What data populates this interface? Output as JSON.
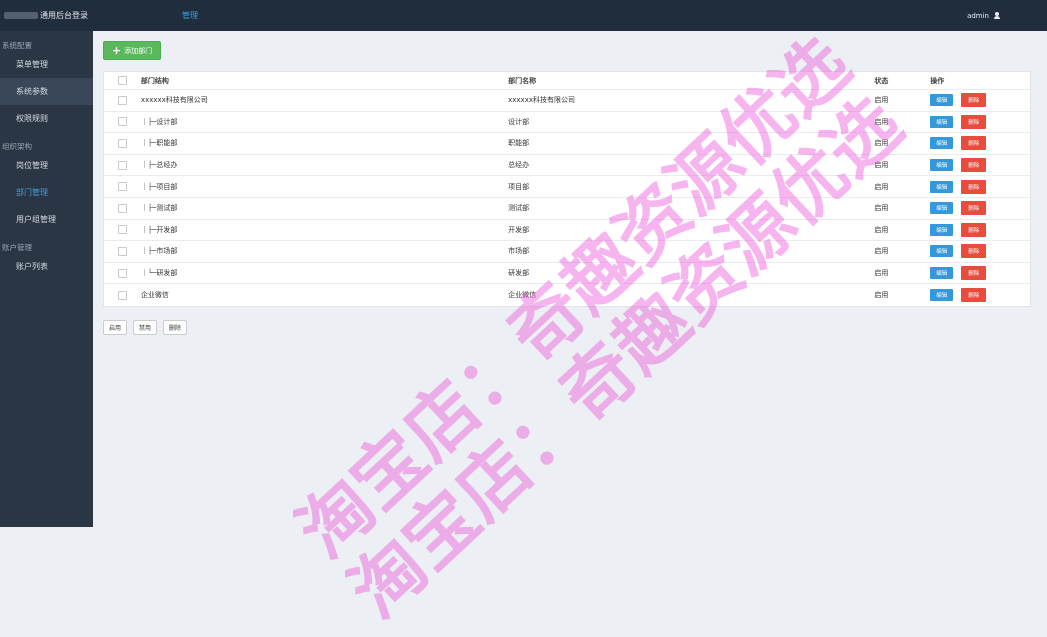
{
  "header": {
    "title": "通用后台登录",
    "nav_manage": "管理",
    "user": "admin"
  },
  "sidebar": {
    "groups": [
      {
        "title": "系统配置",
        "items": [
          "菜单管理",
          "系统参数",
          "权限规则"
        ]
      },
      {
        "title": "组织架构",
        "items": [
          "岗位管理",
          "部门管理",
          "用户组管理"
        ]
      },
      {
        "title": "账户管理",
        "items": [
          "账户列表"
        ]
      }
    ]
  },
  "main": {
    "add_button": "添加部门",
    "table": {
      "headers": [
        "部门结构",
        "部门名称",
        "状态",
        "操作"
      ],
      "edit_label": "编辑",
      "delete_label": "删除",
      "rows": [
        {
          "structure": "xxxxxx科技有限公司",
          "name": "xxxxxx科技有限公司",
          "status": "启用"
        },
        {
          "structure": "｜├─设计部",
          "name": "设计部",
          "status": "启用"
        },
        {
          "structure": "｜├─职能部",
          "name": "职能部",
          "status": "启用"
        },
        {
          "structure": "｜├─总经办",
          "name": "总经办",
          "status": "启用"
        },
        {
          "structure": "｜├─项目部",
          "name": "项目部",
          "status": "启用"
        },
        {
          "structure": "｜├─测试部",
          "name": "测试部",
          "status": "启用"
        },
        {
          "structure": "｜├─开发部",
          "name": "开发部",
          "status": "启用"
        },
        {
          "structure": "｜├─市场部",
          "name": "市场部",
          "status": "启用"
        },
        {
          "structure": "｜└─研发部",
          "name": "研发部",
          "status": "启用"
        },
        {
          "structure": "企业微信",
          "name": "企业微信",
          "status": "启用"
        }
      ]
    },
    "bulk_actions": [
      "启用",
      "禁用",
      "删除"
    ]
  },
  "watermark": {
    "line1": "淘宝店：奇趣资源优选",
    "line2": "淘宝店：奇趣资源优选"
  }
}
